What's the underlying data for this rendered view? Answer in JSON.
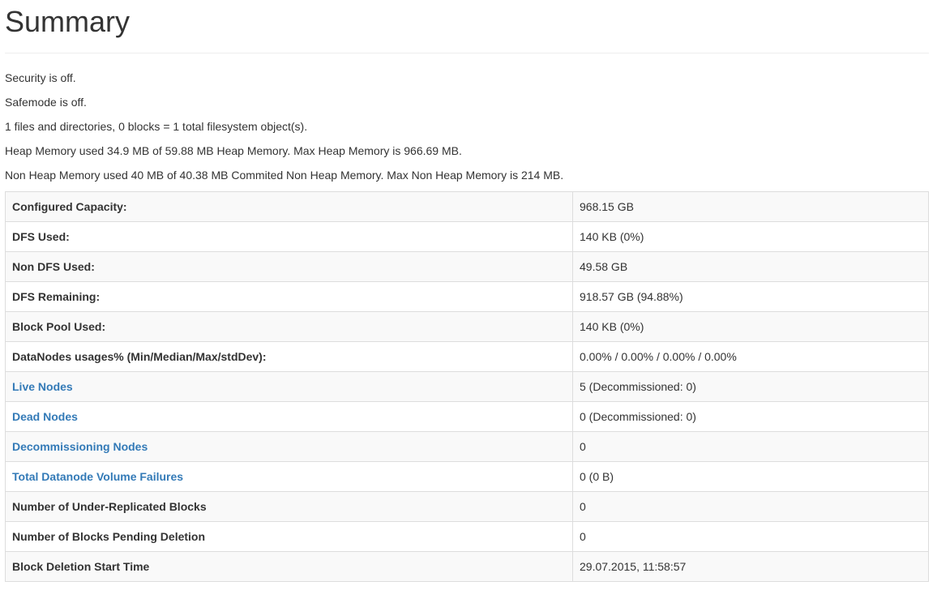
{
  "page": {
    "title": "Summary"
  },
  "info_lines": [
    "Security is off.",
    "Safemode is off.",
    "1 files and directories, 0 blocks = 1 total filesystem object(s).",
    "Heap Memory used 34.9 MB of 59.88 MB Heap Memory. Max Heap Memory is 966.69 MB.",
    "Non Heap Memory used 40 MB of 40.38 MB Commited Non Heap Memory. Max Non Heap Memory is 214 MB."
  ],
  "table": {
    "rows": [
      {
        "key": "Configured Capacity:",
        "value": "968.15 GB"
      },
      {
        "key": "DFS Used:",
        "value": "140 KB (0%)"
      },
      {
        "key": "Non DFS Used:",
        "value": "49.58 GB"
      },
      {
        "key": "DFS Remaining:",
        "value": "918.57 GB (94.88%)"
      },
      {
        "key": "Block Pool Used:",
        "value": "140 KB (0%)"
      },
      {
        "key": "DataNodes usages% (Min/Median/Max/stdDev):",
        "value": "0.00% / 0.00% / 0.00% / 0.00%"
      },
      {
        "key": "Live Nodes",
        "value": "5 (Decommissioned: 0)"
      },
      {
        "key": "Dead Nodes",
        "value": "0 (Decommissioned: 0)"
      },
      {
        "key": "Decommissioning Nodes",
        "value": "0"
      },
      {
        "key": "Total Datanode Volume Failures",
        "value": "0 (0 B)"
      },
      {
        "key": "Number of Under-Replicated Blocks",
        "value": "0"
      },
      {
        "key": "Number of Blocks Pending Deletion",
        "value": "0"
      },
      {
        "key": "Block Deletion Start Time",
        "value": "29.07.2015, 11:58:57"
      }
    ]
  },
  "colors": {
    "link": "#337ab7",
    "text": "#333333",
    "border": "#dddddd",
    "stripe": "#f9f9f9"
  }
}
